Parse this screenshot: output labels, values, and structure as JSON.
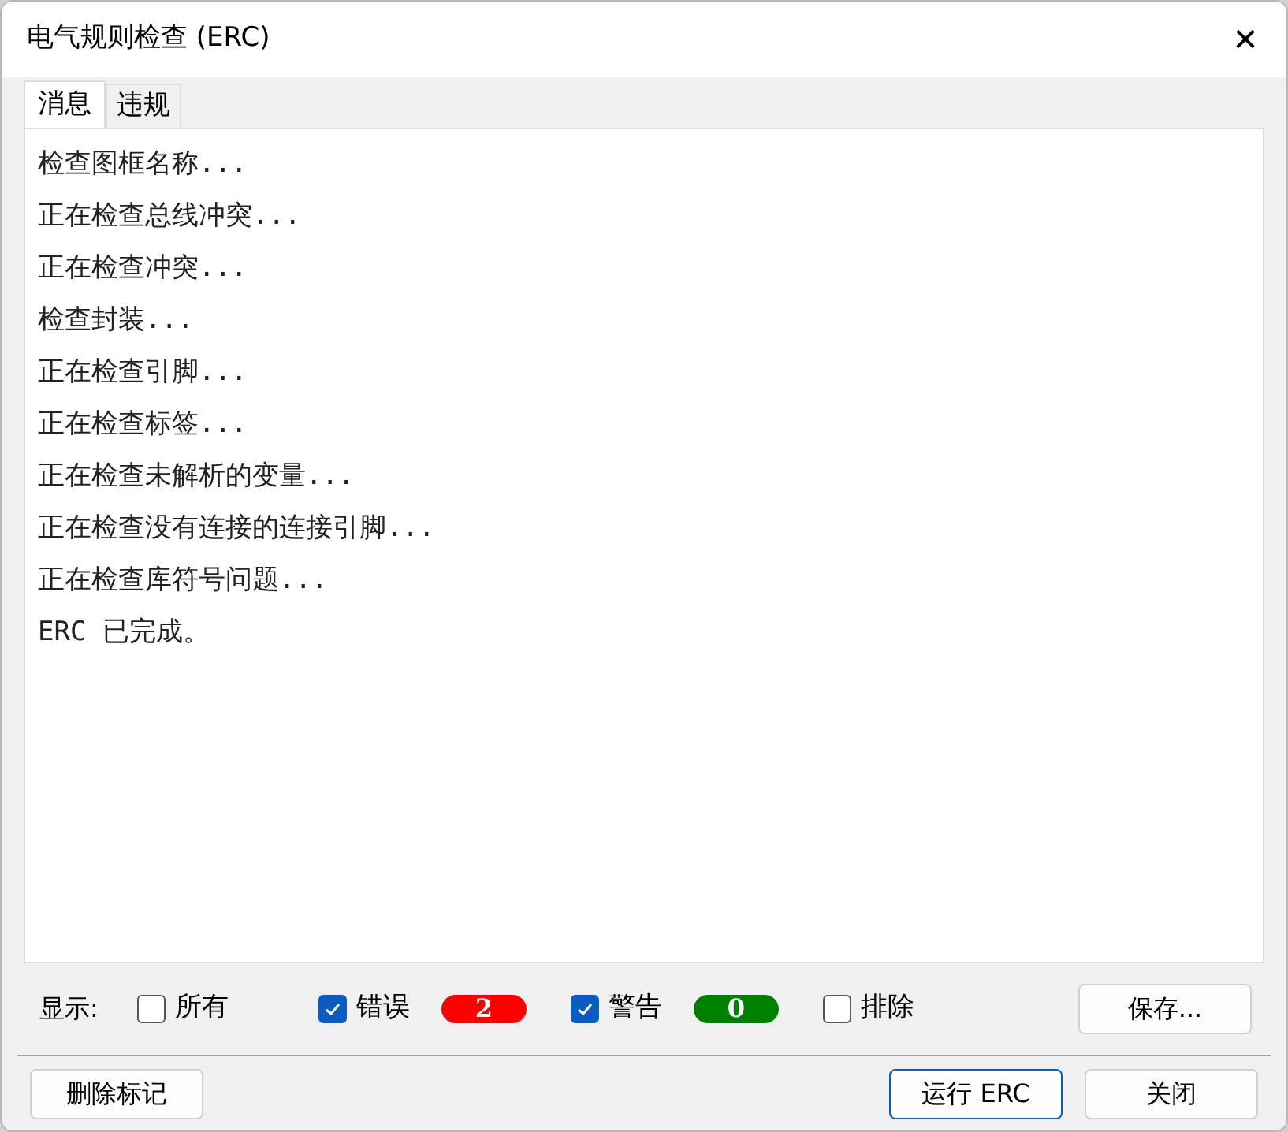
{
  "window": {
    "title": "电气规则检查 (ERC)",
    "close": "✕"
  },
  "tabs": [
    {
      "label": "消息",
      "selected": true
    },
    {
      "label": "违规",
      "selected": false
    }
  ],
  "messages": [
    "检查图框名称...",
    "正在检查总线冲突...",
    "正在检查冲突...",
    "检查封装...",
    "正在检查引脚...",
    "正在检查标签...",
    "正在检查未解析的变量...",
    "正在检查没有连接的连接引脚...",
    "正在检查库符号问题...",
    "ERC 已完成。"
  ],
  "show_label": "显示:",
  "filters": [
    {
      "label": "所有",
      "checked": false
    },
    {
      "label": "错误",
      "checked": true,
      "count": "2",
      "color": "#ff0000"
    },
    {
      "label": "警告",
      "checked": true,
      "count": "0",
      "color": "#008000"
    },
    {
      "label": "排除",
      "checked": false
    }
  ],
  "save_button": "保存...",
  "buttons": [
    {
      "label": "删除标记",
      "kind": "plain"
    },
    {
      "label": "运行 ERC",
      "kind": "default"
    },
    {
      "label": "关闭",
      "kind": "plain"
    }
  ]
}
